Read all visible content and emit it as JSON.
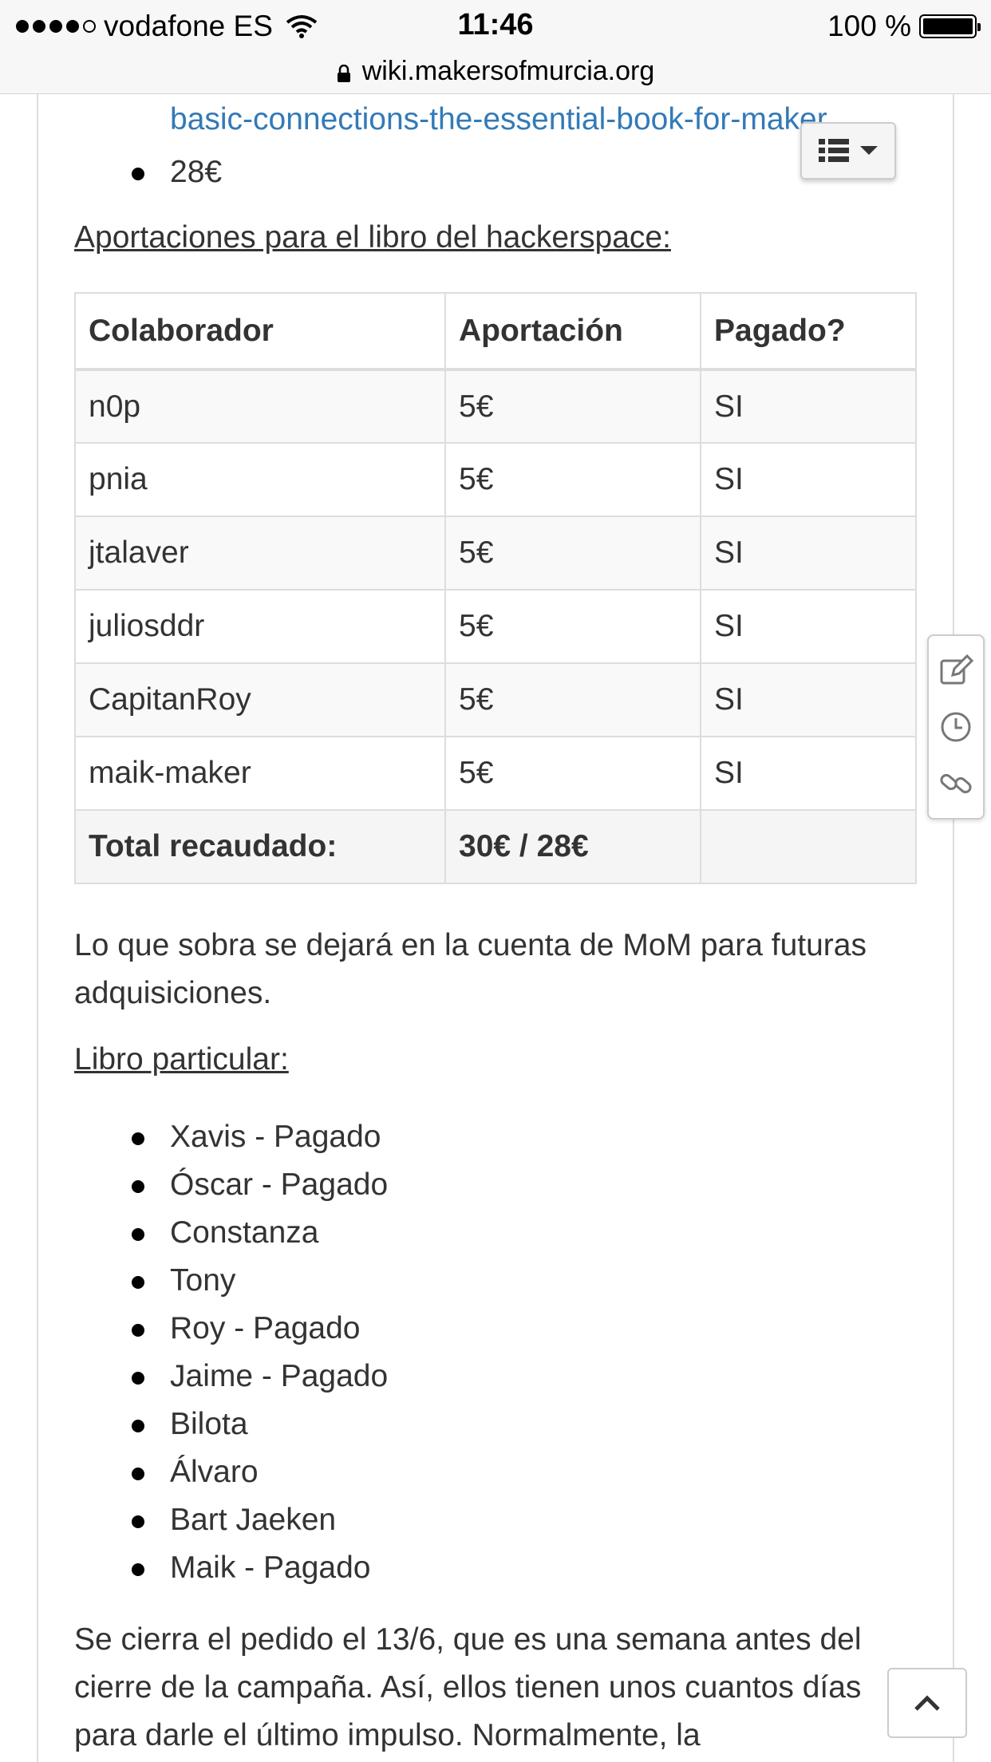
{
  "status_bar": {
    "carrier": "vodafone ES",
    "time": "11:46",
    "battery": "100 %"
  },
  "url_bar": {
    "domain": "wiki.makersofmurcia.org"
  },
  "top_list": {
    "link_text": "basic-connections-the-essential-book-for-maker",
    "price": "28€"
  },
  "section1": {
    "heading": "Aportaciones para el libro del hackerspace:"
  },
  "table": {
    "headers": [
      "Colaborador",
      "Aportación",
      "Pagado?"
    ],
    "rows": [
      [
        "n0p",
        "5€",
        "SI"
      ],
      [
        "pnia",
        "5€",
        "SI"
      ],
      [
        "jtalaver",
        "5€",
        "SI"
      ],
      [
        "juliosddr",
        "5€",
        "SI"
      ],
      [
        "CapitanRoy",
        "5€",
        "SI"
      ],
      [
        "maik-maker",
        "5€",
        "SI"
      ]
    ],
    "total_label": "Total recaudado:",
    "total_value": "30€ / 28€"
  },
  "para1": "Lo que sobra se dejará en la cuenta de MoM para futuras adquisiciones.",
  "section2": {
    "heading": "Libro particular:"
  },
  "people": [
    "Xavis - Pagado",
    "Óscar - Pagado",
    "Constanza",
    "Tony",
    "Roy - Pagado",
    "Jaime - Pagado",
    "Bilota",
    "Álvaro",
    "Bart Jaeken",
    "Maik - Pagado"
  ],
  "para2": "Se cierra el pedido el 13/6, que es una semana antes del cierre de la campaña. Así, ellos tienen unos cuantos días para darle el último impulso. Normalmente, la",
  "icons": {
    "toc": "list-icon",
    "edit": "edit-icon",
    "history": "clock-icon",
    "permalink": "link-icon",
    "back_to_top": "chevron-up-icon"
  }
}
